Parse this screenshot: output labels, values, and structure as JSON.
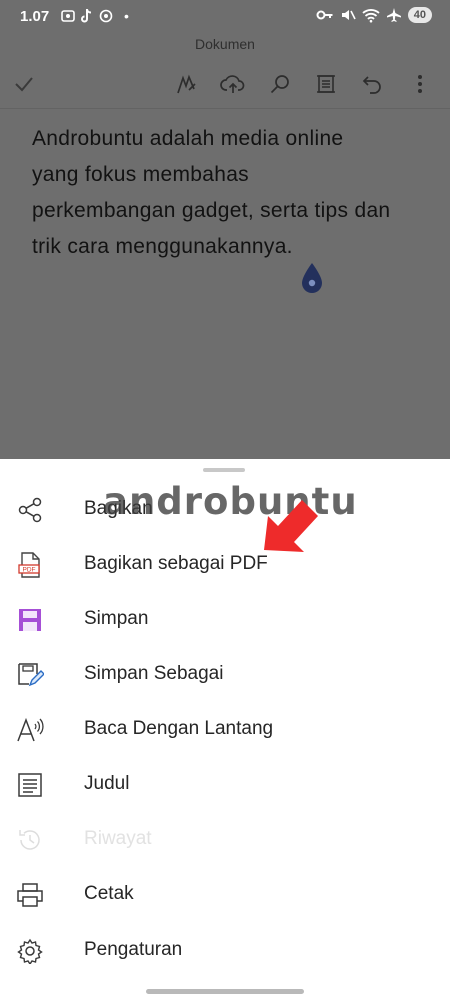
{
  "status_bar": {
    "time": "1.07",
    "battery": "40"
  },
  "document": {
    "title": "Dokumen",
    "lines": [
      "Androbuntu adalah media online",
      "yang fokus membahas",
      "perkembangan gadget, serta tips dan",
      "trik cara menggunakannya."
    ]
  },
  "watermark": "androbuntu",
  "menu": {
    "items": [
      {
        "label": "Bagikan",
        "icon": "share-icon"
      },
      {
        "label": "Bagikan sebagai PDF",
        "icon": "pdf-icon"
      },
      {
        "label": "Simpan",
        "icon": "save-icon"
      },
      {
        "label": "Simpan Sebagai",
        "icon": "save-as-icon"
      },
      {
        "label": "Baca Dengan Lantang",
        "icon": "read-aloud-icon"
      },
      {
        "label": "Judul",
        "icon": "headings-icon"
      },
      {
        "label": "Riwayat",
        "icon": "history-icon",
        "disabled": true
      },
      {
        "label": "Cetak",
        "icon": "print-icon"
      },
      {
        "label": "Pengaturan",
        "icon": "settings-icon"
      }
    ]
  },
  "colors": {
    "dim_overlay": "#6e6e6e",
    "accent_purple": "#a64fd6",
    "pdf_red": "#d33a2c",
    "arrow_red": "#ee2b2b"
  }
}
